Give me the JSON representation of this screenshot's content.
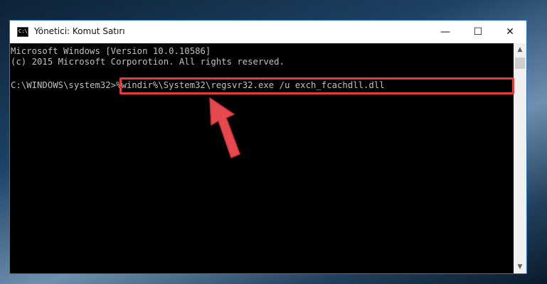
{
  "window": {
    "title": "Yönetici: Komut Satırı",
    "app_icon_text": "C:\\",
    "controls": {
      "minimize": "—",
      "maximize": "☐",
      "close": "✕"
    }
  },
  "console": {
    "lines": [
      "Microsoft Windows [Version 10.0.10586]",
      "(c) 2015 Microsoft Corporotion. All rights reserved.",
      "",
      "C:\\WINDOWS\\system32>%windir%\\System32\\regsvr32.exe /u exch_fcachdll.dll"
    ]
  },
  "scrollbar": {
    "up": "▲",
    "down": "▼"
  },
  "colors": {
    "console_bg": "#000000",
    "console_text": "#c0c0c0",
    "highlight": "#e23b3b",
    "window_border": "#2b78c9"
  }
}
